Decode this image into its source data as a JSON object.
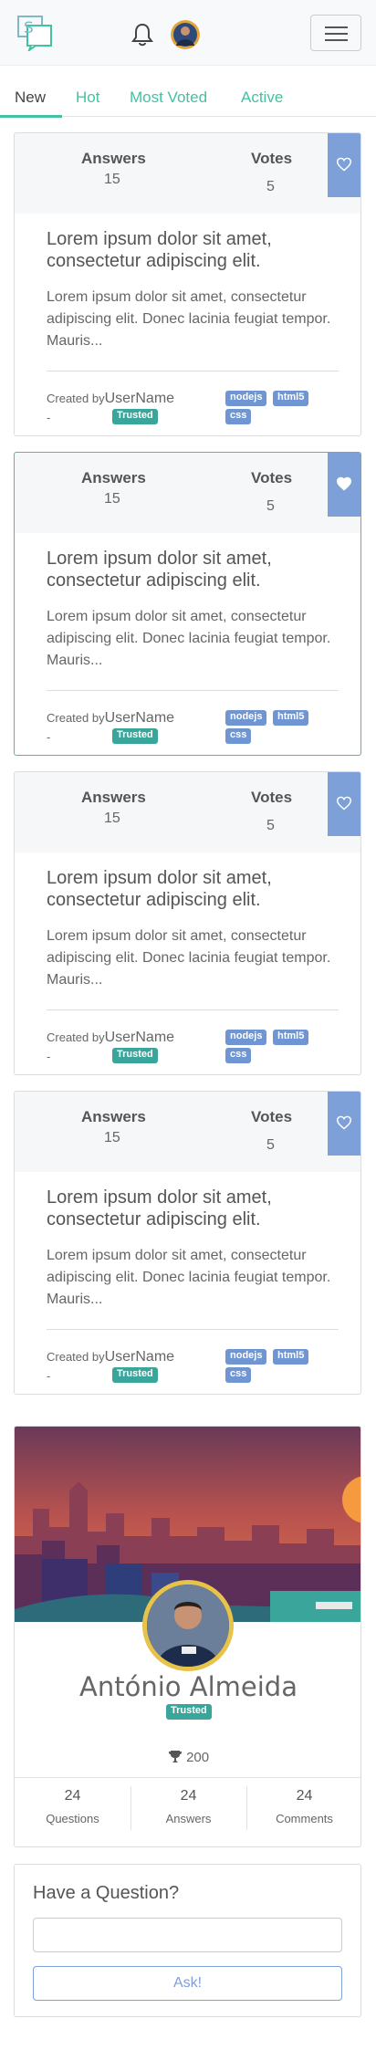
{
  "header": {
    "logo_text": "S",
    "logo_icon": "speech-bubbles-logo",
    "bell_icon": "bell-icon",
    "menu_icon": "hamburger-icon"
  },
  "tabs": [
    {
      "label": "New",
      "active": true
    },
    {
      "label": "Hot",
      "active": false
    },
    {
      "label": "Most Voted",
      "active": false
    },
    {
      "label": "Active",
      "active": false
    }
  ],
  "questions": [
    {
      "answers_label": "Answers",
      "answers": "15",
      "votes_label": "Votes",
      "votes": "5",
      "favorited": false,
      "title": "Lorem ipsum dolor sit amet, consectetur adipiscing elit.",
      "body": "Lorem ipsum dolor sit amet, consectetur adipiscing elit. Donec lacinia feugiat tempor. Mauris...",
      "created_by": "Created by",
      "username": "UserName",
      "dash": "-",
      "badge": "Trusted",
      "tags": [
        "nodejs",
        "html5",
        "css"
      ]
    },
    {
      "answers_label": "Answers",
      "answers": "15",
      "votes_label": "Votes",
      "votes": "5",
      "favorited": true,
      "title": "Lorem ipsum dolor sit amet, consectetur adipiscing elit.",
      "body": "Lorem ipsum dolor sit amet, consectetur adipiscing elit. Donec lacinia feugiat tempor. Mauris...",
      "created_by": "Created by",
      "username": "UserName",
      "dash": "-",
      "badge": "Trusted",
      "tags": [
        "nodejs",
        "html5",
        "css"
      ]
    },
    {
      "answers_label": "Answers",
      "answers": "15",
      "votes_label": "Votes",
      "votes": "5",
      "favorited": false,
      "title": "Lorem ipsum dolor sit amet, consectetur adipiscing elit.",
      "body": "Lorem ipsum dolor sit amet, consectetur adipiscing elit. Donec lacinia feugiat tempor. Mauris...",
      "created_by": "Created by",
      "username": "UserName",
      "dash": "-",
      "badge": "Trusted",
      "tags": [
        "nodejs",
        "html5",
        "css"
      ]
    },
    {
      "answers_label": "Answers",
      "answers": "15",
      "votes_label": "Votes",
      "votes": "5",
      "favorited": false,
      "title": "Lorem ipsum dolor sit amet, consectetur adipiscing elit.",
      "body": "Lorem ipsum dolor sit amet, consectetur adipiscing elit. Donec lacinia feugiat tempor. Mauris...",
      "created_by": "Created by",
      "username": "UserName",
      "dash": "-",
      "badge": "Trusted",
      "tags": [
        "nodejs",
        "html5",
        "css"
      ]
    }
  ],
  "profile": {
    "name": "António Almeida",
    "badge": "Trusted",
    "score": "200",
    "score_icon": "trophy-icon",
    "stats": [
      {
        "value": "24",
        "label": "Questions"
      },
      {
        "value": "24",
        "label": "Answers"
      },
      {
        "value": "24",
        "label": "Comments"
      }
    ]
  },
  "ask": {
    "title": "Have a Question?",
    "input_placeholder": "",
    "button_label": "Ask!"
  },
  "colors": {
    "accent_green": "#42c2a1",
    "accent_blue": "#7da0d8",
    "badge_green": "#3aa59a",
    "tag_blue": "#6f96d2"
  }
}
